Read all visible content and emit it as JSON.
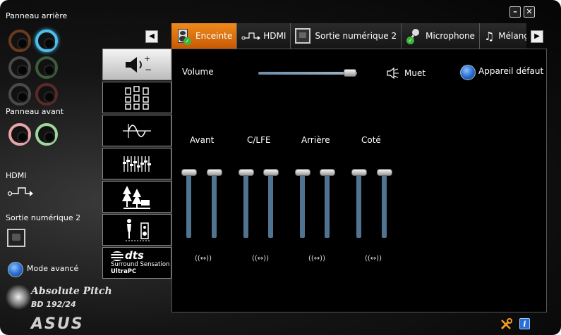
{
  "left_panel": {
    "rear_panel_label": "Panneau arrière",
    "front_panel_label": "Panneau avant",
    "hdmi_label": "HDMI",
    "digital_out_label": "Sortie numérique 2",
    "advanced_mode_label": "Mode avancé"
  },
  "tabs": [
    {
      "label": "Enceinte",
      "icon": "speaker-icon",
      "active": true
    },
    {
      "label": "HDMI",
      "icon": "hdmi-icon",
      "active": false
    },
    {
      "label": "Sortie numérique 2",
      "icon": "digital-out-icon",
      "active": false
    },
    {
      "label": "Microphone",
      "icon": "microphone-icon",
      "active": false
    },
    {
      "label": "Mélange sté",
      "icon": "music-note-icon",
      "active": false
    }
  ],
  "window_buttons": {
    "minimize": "–",
    "close": "✕"
  },
  "nav": {
    "left": "◀",
    "right": "▶"
  },
  "toolbar_items": [
    {
      "name": "volume-tool",
      "icon": "speaker-volume-icon",
      "active": true
    },
    {
      "name": "speaker-config-tool",
      "icon": "speaker-config-icon",
      "active": false
    },
    {
      "name": "sound-effects-tool",
      "icon": "wave-icon",
      "active": false
    },
    {
      "name": "equalizer-tool",
      "icon": "equalizer-icon",
      "active": false
    },
    {
      "name": "environment-tool",
      "icon": "environment-icon",
      "active": false
    },
    {
      "name": "room-correction-tool",
      "icon": "room-correction-icon",
      "active": false
    },
    {
      "name": "dts-tool",
      "icon": "dts-logo",
      "active": false,
      "line1": "dts",
      "line2": "Surround Sensation",
      "line3": "UltraPC"
    }
  ],
  "main": {
    "volume_label": "Volume",
    "volume_level": 0.93,
    "mute_label": "Muet",
    "default_device_label": "Appareil défaut",
    "channels": [
      {
        "label": "Avant",
        "link": "((↔))"
      },
      {
        "label": "C/LFE",
        "link": "((↔))"
      },
      {
        "label": "Arrière",
        "link": "((↔))"
      },
      {
        "label": "Coté",
        "link": "((↔))"
      }
    ]
  },
  "branding": {
    "absolute_pitch": "Absolute Pitch",
    "bd": "BD 192/24",
    "asus": "ASUS"
  },
  "colors": {
    "active_tab": "#e8780f",
    "slider_track": "#4f7390",
    "jack_blue": "#4bc0f0"
  }
}
